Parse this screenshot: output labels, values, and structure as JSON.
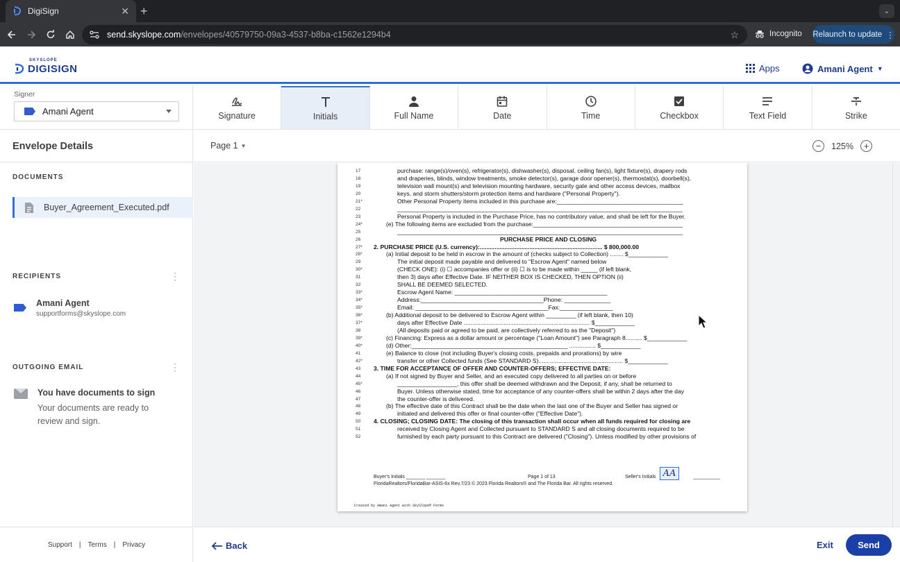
{
  "browser": {
    "tab_title": "DigiSign",
    "url_host": "send.skyslope.com",
    "url_path": "/envelopes/40579750-09a3-4537-b8ba-c1562e1294b4",
    "incognito_label": "Incognito",
    "relaunch_label": "Relaunch to update"
  },
  "app": {
    "logo_top": "SKYSLOPE",
    "logo_name": "DIGISIGN",
    "apps_label": "Apps",
    "user_label": "Amani Agent"
  },
  "signer": {
    "label": "Signer",
    "selected": "Amani Agent"
  },
  "tools": [
    {
      "label": "Signature",
      "icon": "signature-icon"
    },
    {
      "label": "Initials",
      "icon": "initials-icon",
      "active": true
    },
    {
      "label": "Full Name",
      "icon": "person-icon"
    },
    {
      "label": "Date",
      "icon": "calendar-icon"
    },
    {
      "label": "Time",
      "icon": "clock-icon"
    },
    {
      "label": "Checkbox",
      "icon": "checkbox-icon"
    },
    {
      "label": "Text Field",
      "icon": "text-field-icon"
    },
    {
      "label": "Strike",
      "icon": "strike-icon"
    }
  ],
  "left": {
    "title": "Envelope Details",
    "documents_header": "DOCUMENTS",
    "document_name": "Buyer_Agreement_Executed.pdf",
    "recipients_header": "RECIPIENTS",
    "recipient_name": "Amani Agent",
    "recipient_email": "supportforms@skyslope.com",
    "outgoing_header": "OUTGOING EMAIL",
    "email_subject": "You have documents to sign",
    "email_body": "Your documents are ready to review and sign.",
    "footer_links": [
      "Support",
      "Terms",
      "Privacy"
    ]
  },
  "viewer": {
    "page_label": "Page 1",
    "zoom_label": "125%"
  },
  "document_lines": [
    {
      "no": "17",
      "text": "purchase: range(s)/oven(s), refrigerator(s), dishwasher(s), disposal, ceiling fan(s), light fixture(s), drapery rods"
    },
    {
      "no": "18",
      "text": "and draperies, blinds, window treatments, smoke detector(s), garage door opener(s), thermostat(s), doorbell(s),"
    },
    {
      "no": "19",
      "text": "television wall mount(s) and television mounting hardware, security gate and other access devices, mailbox"
    },
    {
      "no": "20",
      "text": "keys, and storm shutters/storm protection items and hardware (\"Personal Property\")."
    },
    {
      "no": "21*",
      "text": "Other Personal Property items included in this purchase are:______________________________________"
    },
    {
      "no": "22",
      "text": "______________________________________________________________________________________"
    },
    {
      "no": "23",
      "text": "Personal Property is included in the Purchase Price, has no contributory value, and shall be left for the Buyer."
    },
    {
      "no": "24*",
      "text": "(e)  The following items are excluded from the purchase:_____________________________________________"
    },
    {
      "no": "25",
      "text": "______________________________________________________________________________________"
    },
    {
      "no": "26",
      "text": "PURCHASE PRICE AND CLOSING"
    },
    {
      "no": "27*",
      "text": "2.   PURCHASE PRICE (U.S. currency):.......................................................................... $ 800,000.00"
    },
    {
      "no": "28*",
      "text": "(a)  Initial deposit to be held in escrow in the amount of (checks subject to Collection) ........ $____________"
    },
    {
      "no": "29",
      "text": "The initial deposit made payable and delivered to \"Escrow Agent\" named below"
    },
    {
      "no": "30*",
      "text": "(CHECK ONE): (i) ☐ accompanies offer or (ii) ☐ is to be made within _____ (if left blank,"
    },
    {
      "no": "31",
      "text": "then 3) days after Effective Date. IF NEITHER BOX IS CHECKED, THEN OPTION (ii)"
    },
    {
      "no": "32",
      "text": "SHALL BE DEEMED SELECTED."
    },
    {
      "no": "33*",
      "text": "Escrow Agent Name: ______________________________________________"
    },
    {
      "no": "34*",
      "text": "Address:_____________________________________Phone: ______________"
    },
    {
      "no": "35*",
      "text": "Email: ________________________________________Fax:________________"
    },
    {
      "no": "36*",
      "text": "(b)  Additional deposit to be delivered to Escrow Agent within _________ (if left blank, then 10)"
    },
    {
      "no": "37*",
      "text": "days after Effective Date ............................................................................ $____________"
    },
    {
      "no": "38",
      "text": "(All deposits paid or agreed to be paid, are collectively referred to as the \"Deposit\")"
    },
    {
      "no": "39*",
      "text": "(c)  Financing: Express as a dollar amount or percentage (\"Loan Amount\") see Paragraph 8.......... $____________"
    },
    {
      "no": "40*",
      "text": "(d)  Other:_______________________________________________ ................ $____________"
    },
    {
      "no": "41",
      "text": "(e)  Balance to close (not including Buyer's closing costs, prepaids and prorations) by wire"
    },
    {
      "no": "42*",
      "text": "transfer or other Collected funds (See STANDARD S)................................................... $____________"
    },
    {
      "no": "43",
      "text": "3.   TIME FOR ACCEPTANCE OF OFFER AND COUNTER-OFFERS; EFFECTIVE DATE:"
    },
    {
      "no": "44",
      "text": "(a)  If not signed by Buyer and Seller, and an executed copy delivered to all parties on or before"
    },
    {
      "no": "45*",
      "text": "__________________, this offer shall be deemed withdrawn and the Deposit, if any, shall be returned to"
    },
    {
      "no": "46",
      "text": "Buyer. Unless otherwise stated, time for acceptance of any counter-offers shall be within 2 days after the day"
    },
    {
      "no": "47",
      "text": "the counter-offer is delivered."
    },
    {
      "no": "48",
      "text": "(b)  The effective date of this Contract shall be the date when the last one of the Buyer and Seller has signed or"
    },
    {
      "no": "49",
      "text": "initialed and delivered this offer or final counter-offer (\"Effective Date\")."
    },
    {
      "no": "50",
      "text": "4.   CLOSING; CLOSING DATE: The closing of this transaction shall occur when all funds required for closing are"
    },
    {
      "no": "51",
      "text": "received by Closing Agent and Collected pursuant to STANDARD S and all closing documents required to be"
    },
    {
      "no": "52",
      "text": "furnished by each party pursuant to this Contract are delivered (\"Closing\"). Unless modified by other provisions of"
    }
  ],
  "page_footer": {
    "buyers_initials": "Buyer's Initials _______ _______",
    "page_of": "Page 1 of 13",
    "sellers_initials": "Seller's Initials",
    "form_line": "FloridaRealtors/FloridaBar-ASIS-6x    Rev.7/23 © 2023 Florida Realtors® and The Florida Bar.  All rights reserved.",
    "created_by": "Created by Amani Agent with SkySlope® Forms",
    "initials_value": "AA"
  },
  "bottom": {
    "back_label": "Back",
    "exit_label": "Exit",
    "send_label": "Send"
  }
}
